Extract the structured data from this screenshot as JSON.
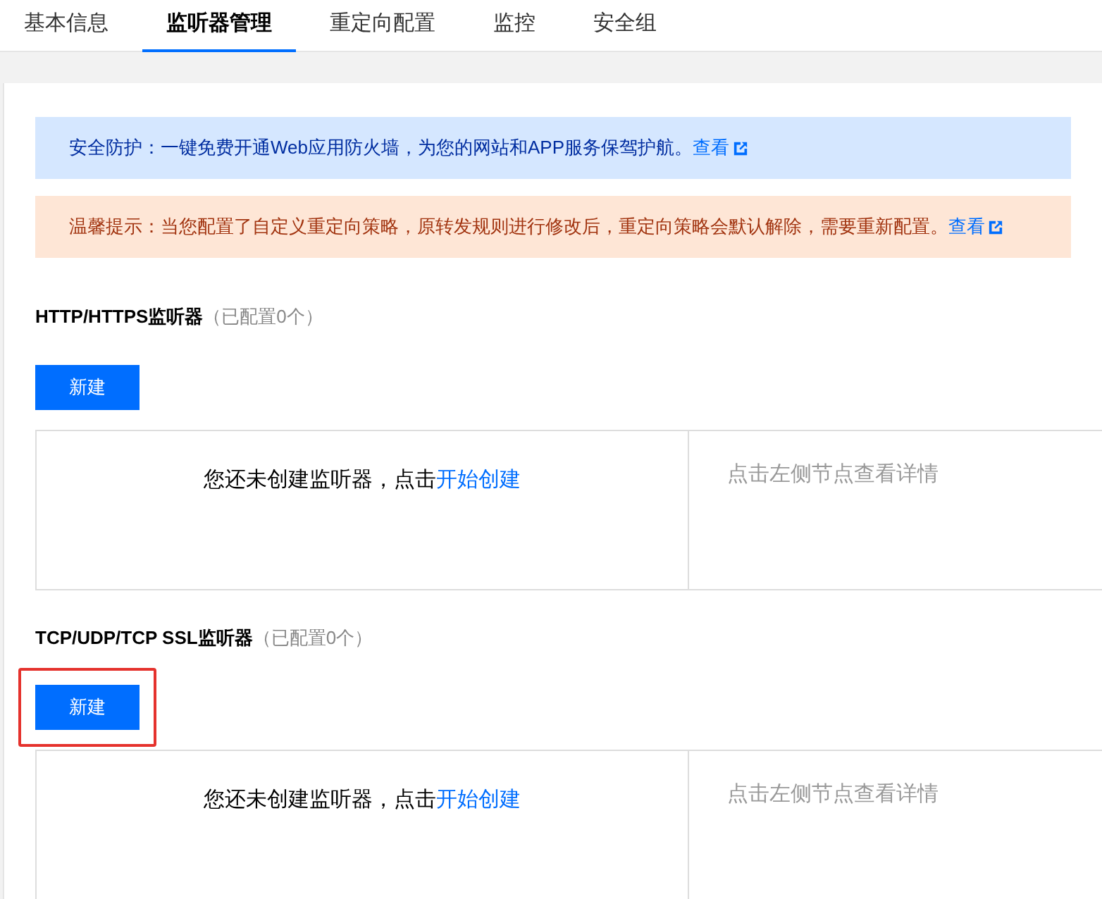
{
  "tabs": [
    {
      "label": "基本信息",
      "selected": false
    },
    {
      "label": "监听器管理",
      "selected": true
    },
    {
      "label": "重定向配置",
      "selected": false
    },
    {
      "label": "监控",
      "selected": false
    },
    {
      "label": "安全组",
      "selected": false
    }
  ],
  "notices": [
    {
      "kind": "info",
      "text": "安全防护：一键免费开通Web应用防火墙，为您的网站和APP服务保驾护航。",
      "link": "查看"
    },
    {
      "kind": "warning",
      "text": "温馨提示：当您配置了自定义重定向策略，原转发规则进行修改后，重定向策略会默认解除，需要重新配置。",
      "link": "查看"
    }
  ],
  "sections": [
    {
      "title": "HTTP/HTTPS监听器",
      "count": "（已配置0个）",
      "button": "新建",
      "highlighted": false,
      "empty_text": "您还未创建监听器，点击",
      "empty_link": "开始创建",
      "detail_hint": "点击左侧节点查看详情"
    },
    {
      "title": "TCP/UDP/TCP SSL监听器",
      "count": "（已配置0个）",
      "button": "新建",
      "highlighted": true,
      "empty_text": "您还未创建监听器，点击",
      "empty_link": "开始创建",
      "detail_hint": "点击左侧节点查看详情"
    }
  ]
}
